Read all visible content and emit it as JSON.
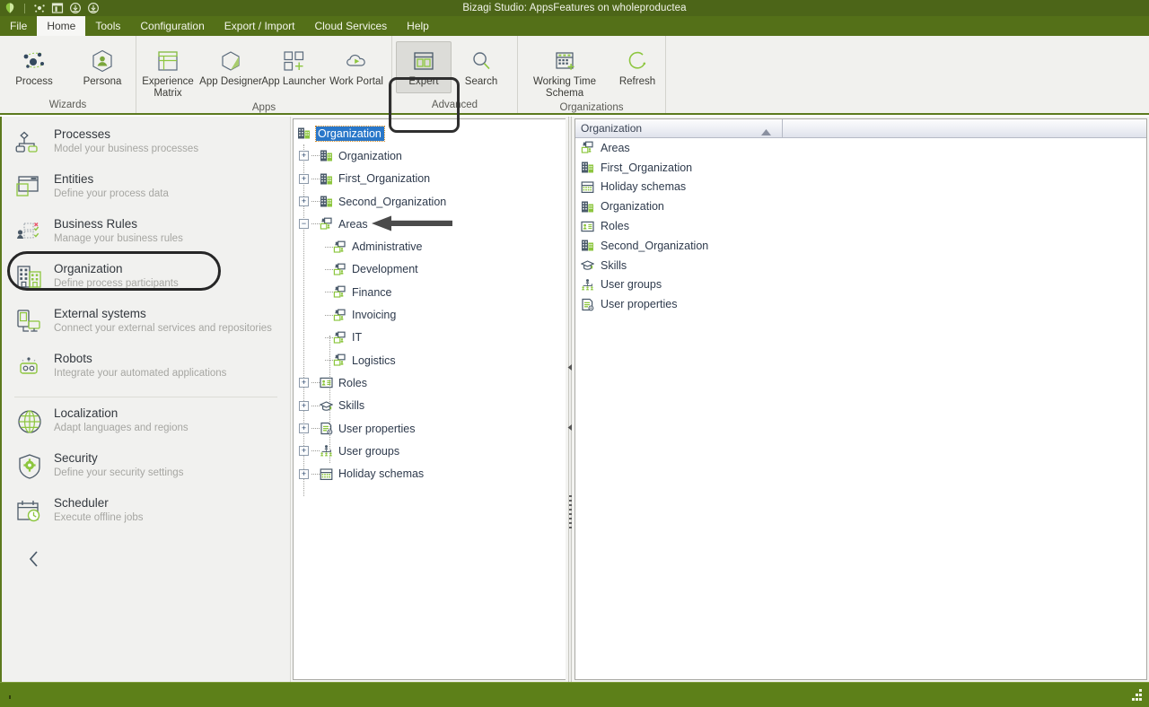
{
  "window": {
    "title": "Bizagi Studio: AppsFeatures  on  wholeproductea",
    "titlebar_icons": [
      "bizagi-logo-icon",
      "process-wizard-icon",
      "panel-layout-icon",
      "download-icon",
      "download-alt-icon"
    ],
    "accent_green": "#4c6518",
    "ribbon_green": "#547018",
    "status_green": "#5d8019"
  },
  "menu": {
    "items": [
      {
        "label": "File",
        "active": false
      },
      {
        "label": "Home",
        "active": true
      },
      {
        "label": "Tools",
        "active": false
      },
      {
        "label": "Configuration",
        "active": false
      },
      {
        "label": "Export / Import",
        "active": false
      },
      {
        "label": "Cloud Services",
        "active": false
      },
      {
        "label": "Help",
        "active": false
      }
    ]
  },
  "ribbon": {
    "groups": [
      {
        "label": "Wizards",
        "buttons": [
          {
            "label": "Process",
            "icon": "process-dots-icon",
            "selected": false
          },
          {
            "label": "Persona",
            "icon": "persona-hexagon-icon",
            "selected": false
          }
        ]
      },
      {
        "label": "Apps",
        "buttons": [
          {
            "label": "Experience Matrix",
            "icon": "experience-matrix-icon",
            "selected": false
          },
          {
            "label": "App Designer",
            "icon": "app-designer-icon",
            "selected": false
          },
          {
            "label": "App Launcher",
            "icon": "app-launcher-icon",
            "selected": false
          },
          {
            "label": "Work Portal",
            "icon": "work-portal-cloud-icon",
            "selected": false
          }
        ]
      },
      {
        "label": "Advanced",
        "buttons": [
          {
            "label": "Expert",
            "icon": "expert-panels-icon",
            "selected": true
          },
          {
            "label": "Search",
            "icon": "search-icon",
            "selected": false
          }
        ]
      },
      {
        "label": "Organizations",
        "buttons": [
          {
            "label": "Working Time Schema",
            "icon": "working-time-schema-icon",
            "selected": false
          },
          {
            "label": "Refresh",
            "icon": "refresh-icon",
            "selected": false
          }
        ]
      }
    ]
  },
  "sidebar": {
    "items": [
      {
        "label": "Processes",
        "sub": "Model your business processes",
        "icon": "processes-icon",
        "highlighted": false
      },
      {
        "label": "Entities",
        "sub": "Define your process data",
        "icon": "entities-icon",
        "highlighted": false
      },
      {
        "label": "Business Rules",
        "sub": "Manage your business rules",
        "icon": "business-rules-icon",
        "highlighted": false
      },
      {
        "label": "Organization",
        "sub": "Define process participants",
        "icon": "organization-icon",
        "highlighted": true
      },
      {
        "label": "External systems",
        "sub": "Connect your external services and repositories",
        "icon": "external-systems-icon",
        "highlighted": false
      },
      {
        "label": "Robots",
        "sub": "Integrate your automated applications",
        "icon": "robots-icon",
        "highlighted": false
      },
      {
        "label": "Localization",
        "sub": "Adapt languages and regions",
        "icon": "localization-globe-icon",
        "highlighted": false
      },
      {
        "label": "Security",
        "sub": "Define your security settings",
        "icon": "security-shield-icon",
        "highlighted": false
      },
      {
        "label": "Scheduler",
        "sub": "Execute offline jobs",
        "icon": "scheduler-calendar-icon",
        "highlighted": false
      }
    ],
    "collapse_glyph": "‹"
  },
  "tree": {
    "root": {
      "label": "Organization",
      "icon": "organization-icon",
      "selected": true
    },
    "nodes": [
      {
        "label": "Organization",
        "icon": "organization-icon",
        "expander": "+",
        "level": 1
      },
      {
        "label": "First_Organization",
        "icon": "organization-icon",
        "expander": "+",
        "level": 1
      },
      {
        "label": "Second_Organization",
        "icon": "organization-icon",
        "expander": "+",
        "level": 1
      },
      {
        "label": "Areas",
        "icon": "areas-icon",
        "expander": "−",
        "level": 1,
        "annotated": true
      },
      {
        "label": "Administrative",
        "icon": "areas-icon",
        "expander": "",
        "level": 2
      },
      {
        "label": "Development",
        "icon": "areas-icon",
        "expander": "",
        "level": 2
      },
      {
        "label": "Finance",
        "icon": "areas-icon",
        "expander": "",
        "level": 2
      },
      {
        "label": "Invoicing",
        "icon": "areas-icon",
        "expander": "",
        "level": 2
      },
      {
        "label": "IT",
        "icon": "areas-icon",
        "expander": "",
        "level": 2
      },
      {
        "label": "Logistics",
        "icon": "areas-icon",
        "expander": "",
        "level": 2
      },
      {
        "label": "Roles",
        "icon": "roles-icon",
        "expander": "+",
        "level": 1
      },
      {
        "label": "Skills",
        "icon": "skills-icon",
        "expander": "+",
        "level": 1
      },
      {
        "label": "User properties",
        "icon": "user-properties-icon",
        "expander": "+",
        "level": 1
      },
      {
        "label": "User groups",
        "icon": "user-groups-icon",
        "expander": "+",
        "level": 1
      },
      {
        "label": "Holiday schemas",
        "icon": "holiday-schemas-icon",
        "expander": "+",
        "level": 1
      }
    ]
  },
  "list": {
    "columns": [
      {
        "label": "Organization",
        "sort": "ascending"
      },
      {
        "label": "",
        "sort": ""
      }
    ],
    "rows": [
      {
        "label": "Areas",
        "icon": "areas-icon"
      },
      {
        "label": "First_Organization",
        "icon": "organization-icon"
      },
      {
        "label": "Holiday schemas",
        "icon": "holiday-schemas-icon"
      },
      {
        "label": "Organization",
        "icon": "organization-icon"
      },
      {
        "label": "Roles",
        "icon": "roles-icon"
      },
      {
        "label": "Second_Organization",
        "icon": "organization-icon"
      },
      {
        "label": "Skills",
        "icon": "skills-icon"
      },
      {
        "label": "User groups",
        "icon": "user-groups-icon"
      },
      {
        "label": "User properties",
        "icon": "user-properties-icon"
      }
    ]
  },
  "splitter": {
    "collapse_left_glyph": "◂",
    "collapse_right_glyph": "◂"
  },
  "statusbar": {
    "text": "",
    "grip_icon": "resize-grip-icon"
  }
}
